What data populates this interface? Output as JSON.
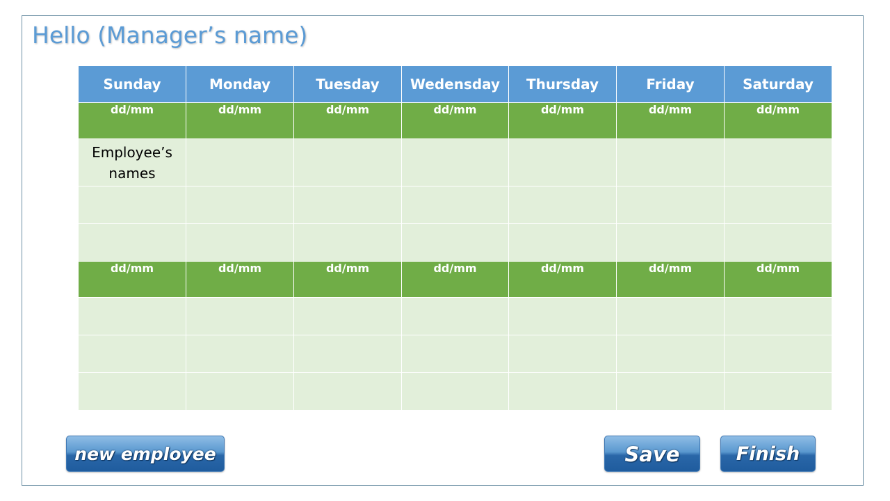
{
  "greeting": "Hello (Manager’s name)",
  "days": [
    "Sunday",
    "Monday",
    "Tuesday",
    "Wedensday",
    "Thursday",
    "Friday",
    "Saturday"
  ],
  "week1": {
    "dates": [
      "dd/mm",
      "dd/mm",
      "dd/mm",
      "dd/mm",
      "dd/mm",
      "dd/mm",
      "dd/mm"
    ],
    "employee_placeholder_line1": "Employee’s",
    "employee_placeholder_line2": "names"
  },
  "week2": {
    "dates": [
      "dd/mm",
      "dd/mm",
      "dd/mm",
      "dd/mm",
      "dd/mm",
      "dd/mm",
      "dd/mm"
    ]
  },
  "buttons": {
    "new_employee": "new employee",
    "save": "Save",
    "finish": "Finish"
  },
  "colors": {
    "header_blue": "#5b9bd5",
    "date_green": "#70ad47",
    "cell_light_green": "#e2efda",
    "button_blue": "#2a67a8"
  }
}
